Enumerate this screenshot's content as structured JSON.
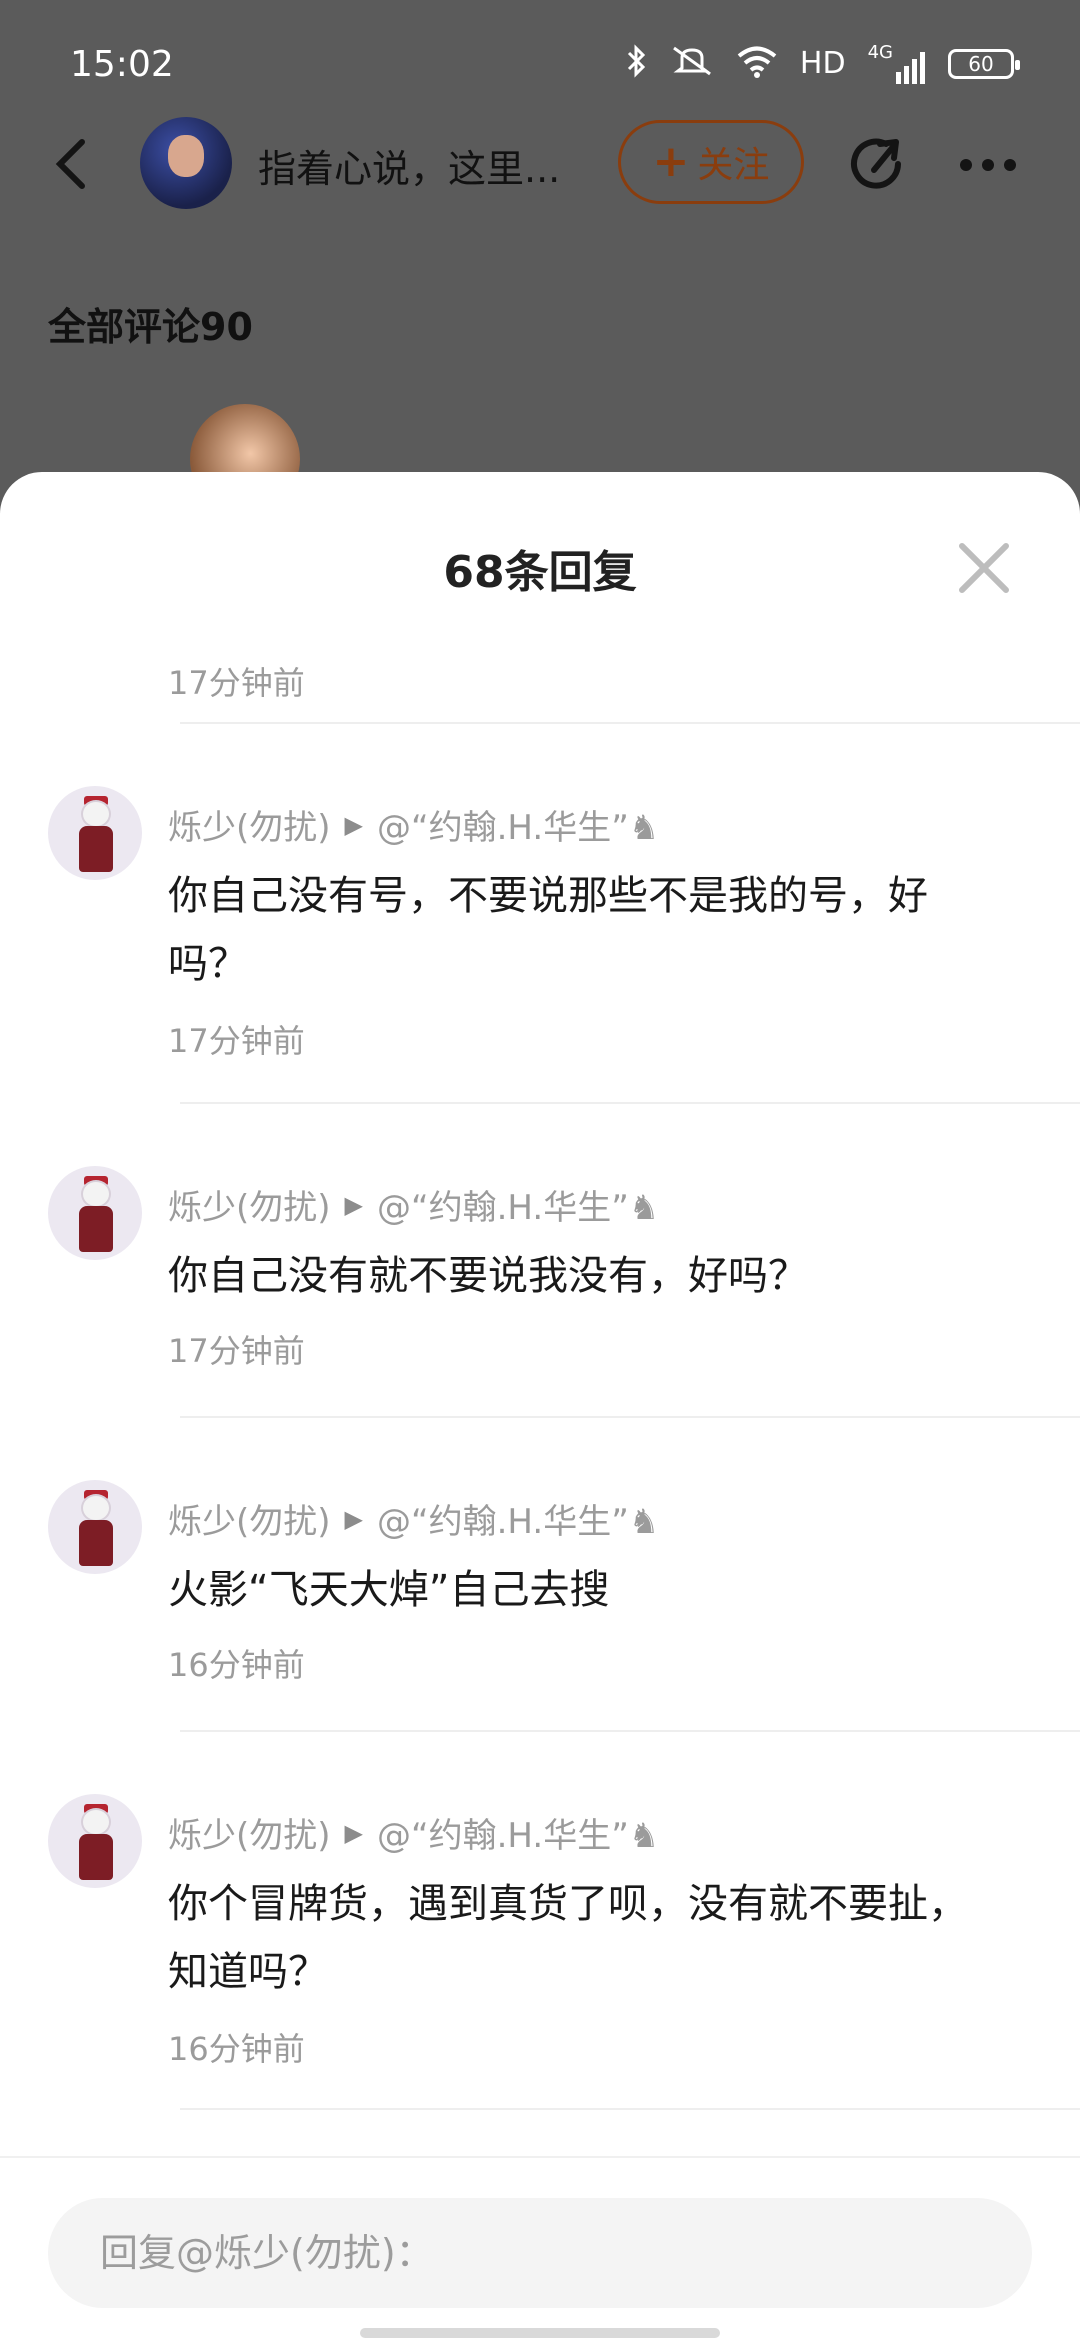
{
  "status_bar": {
    "time": "15:02",
    "icons": [
      "bluetooth-icon",
      "mute-icon",
      "wifi-icon",
      "hd-icon",
      "4g-signal-icon",
      "battery-icon"
    ],
    "hd_label": "HD",
    "network_label": "4G",
    "battery_level": "60"
  },
  "header": {
    "post_title": "指着心说，这里...",
    "follow_label": "关注",
    "follow_plus": "+"
  },
  "comments_header": {
    "label": "全部评论90"
  },
  "sheet": {
    "title": "68条回复",
    "first_reply_time": "17分钟前",
    "replies": [
      {
        "author": "烁少(勿扰)",
        "arrow": "▶",
        "target": "@“约翰.H.华生”♞",
        "text": "你自己没有号，不要说那些不是我的号，好吗？",
        "time": "17分钟前"
      },
      {
        "author": "烁少(勿扰)",
        "arrow": "▶",
        "target": "@“约翰.H.华生”♞",
        "text": "你自己没有就不要说我没有，好吗？",
        "time": "17分钟前"
      },
      {
        "author": "烁少(勿扰)",
        "arrow": "▶",
        "target": "@“约翰.H.华生”♞",
        "text": "火影“飞天大焯”自己去搜",
        "time": "16分钟前"
      },
      {
        "author": "烁少(勿扰)",
        "arrow": "▶",
        "target": "@“约翰.H.华生”♞",
        "text": "你个冒牌货，遇到真货了呗，没有就不要扯，知道吗？",
        "time": "16分钟前"
      }
    ]
  },
  "reply_input": {
    "placeholder": "回复@烁少(勿扰)："
  },
  "colors": {
    "dim_overlay": "#5c5c5c",
    "follow_accent": "#8a3d0e",
    "meta_gray": "#9b9b9b",
    "body_text": "#1a1a1a"
  }
}
